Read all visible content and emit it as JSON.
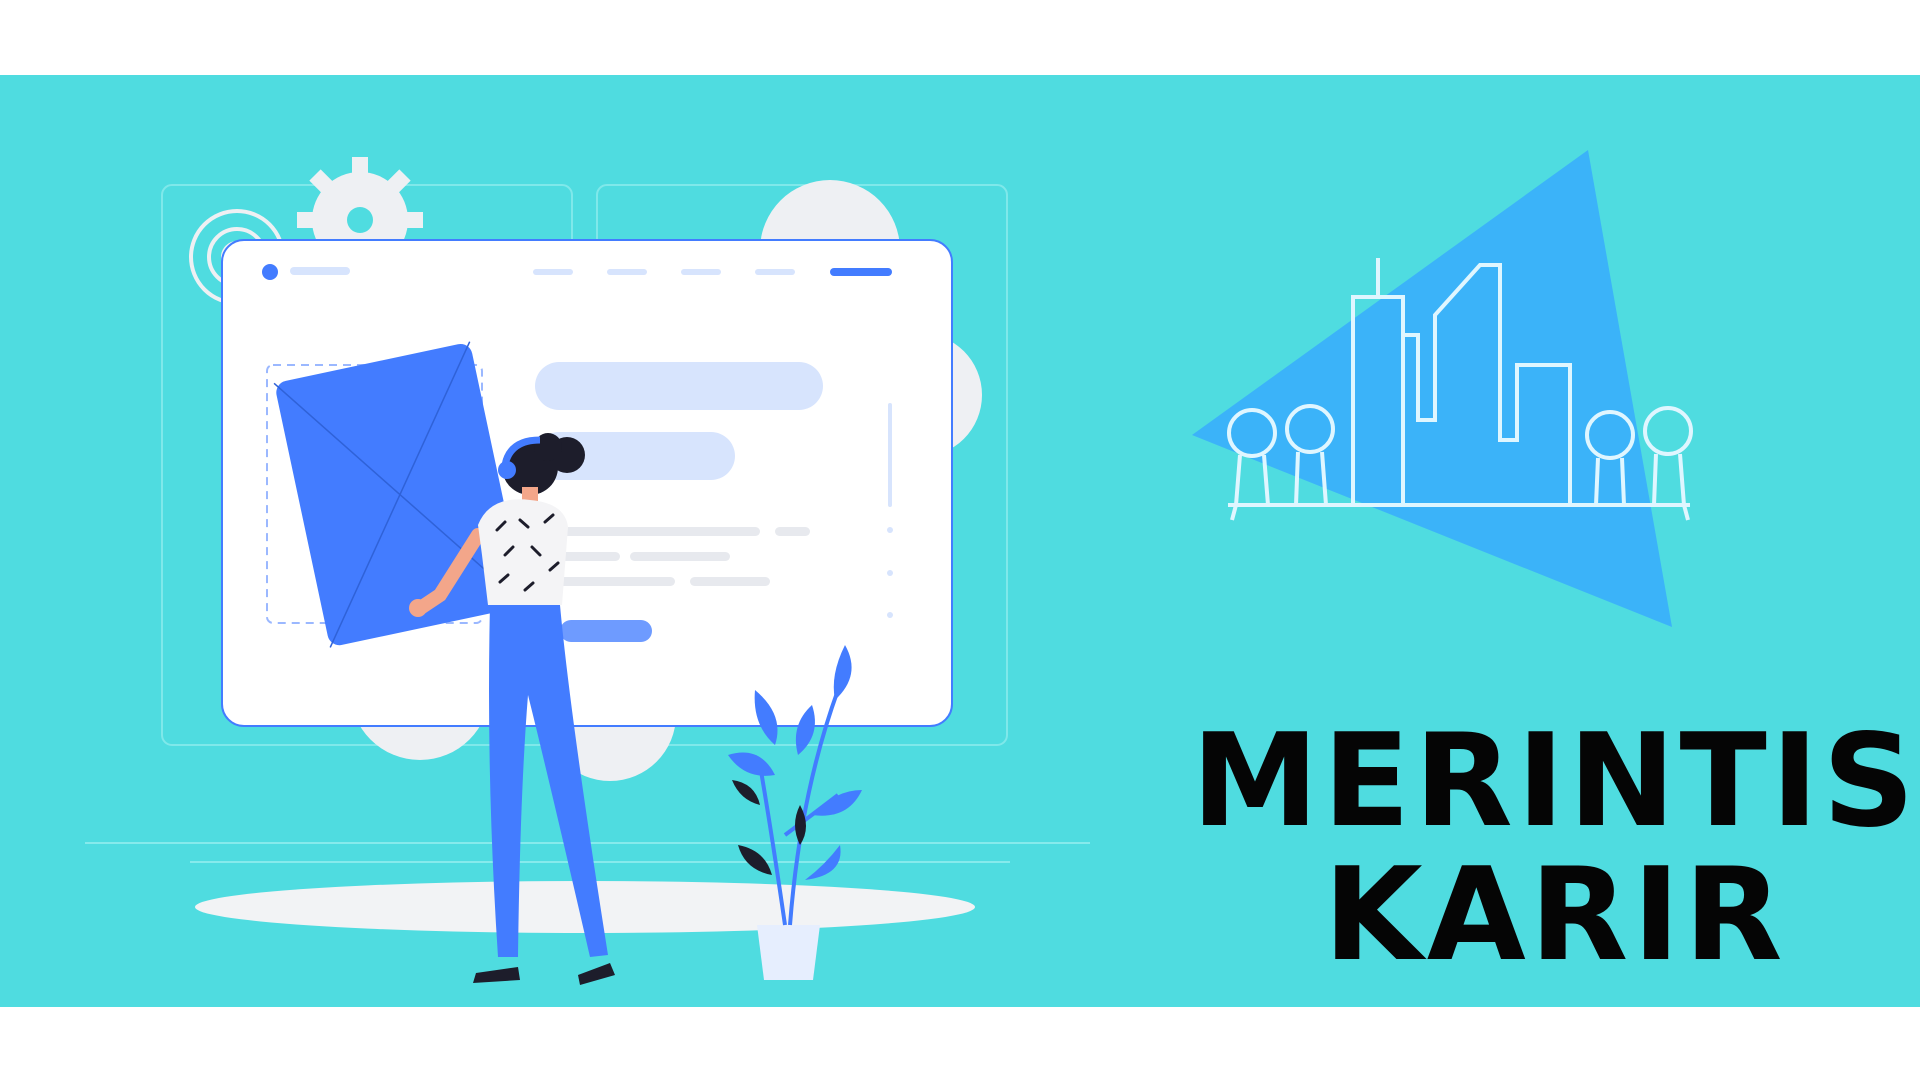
{
  "banner": {
    "background_color": "#4fdce0",
    "title_line_1": "MERINTIS",
    "title_line_2": "KARIR"
  },
  "logo": {
    "triangle_color": "#3bb3f9",
    "outline_color": "#dff6ff",
    "icon": "city-skyline-people-icon"
  },
  "illustration": {
    "subject": "woman-holding-blue-card-at-website-mockup",
    "accent_color": "#437cff",
    "light_accent_color": "#d7e4fd",
    "gear_color": "#eef0f3",
    "plant_color": "#437cff"
  }
}
